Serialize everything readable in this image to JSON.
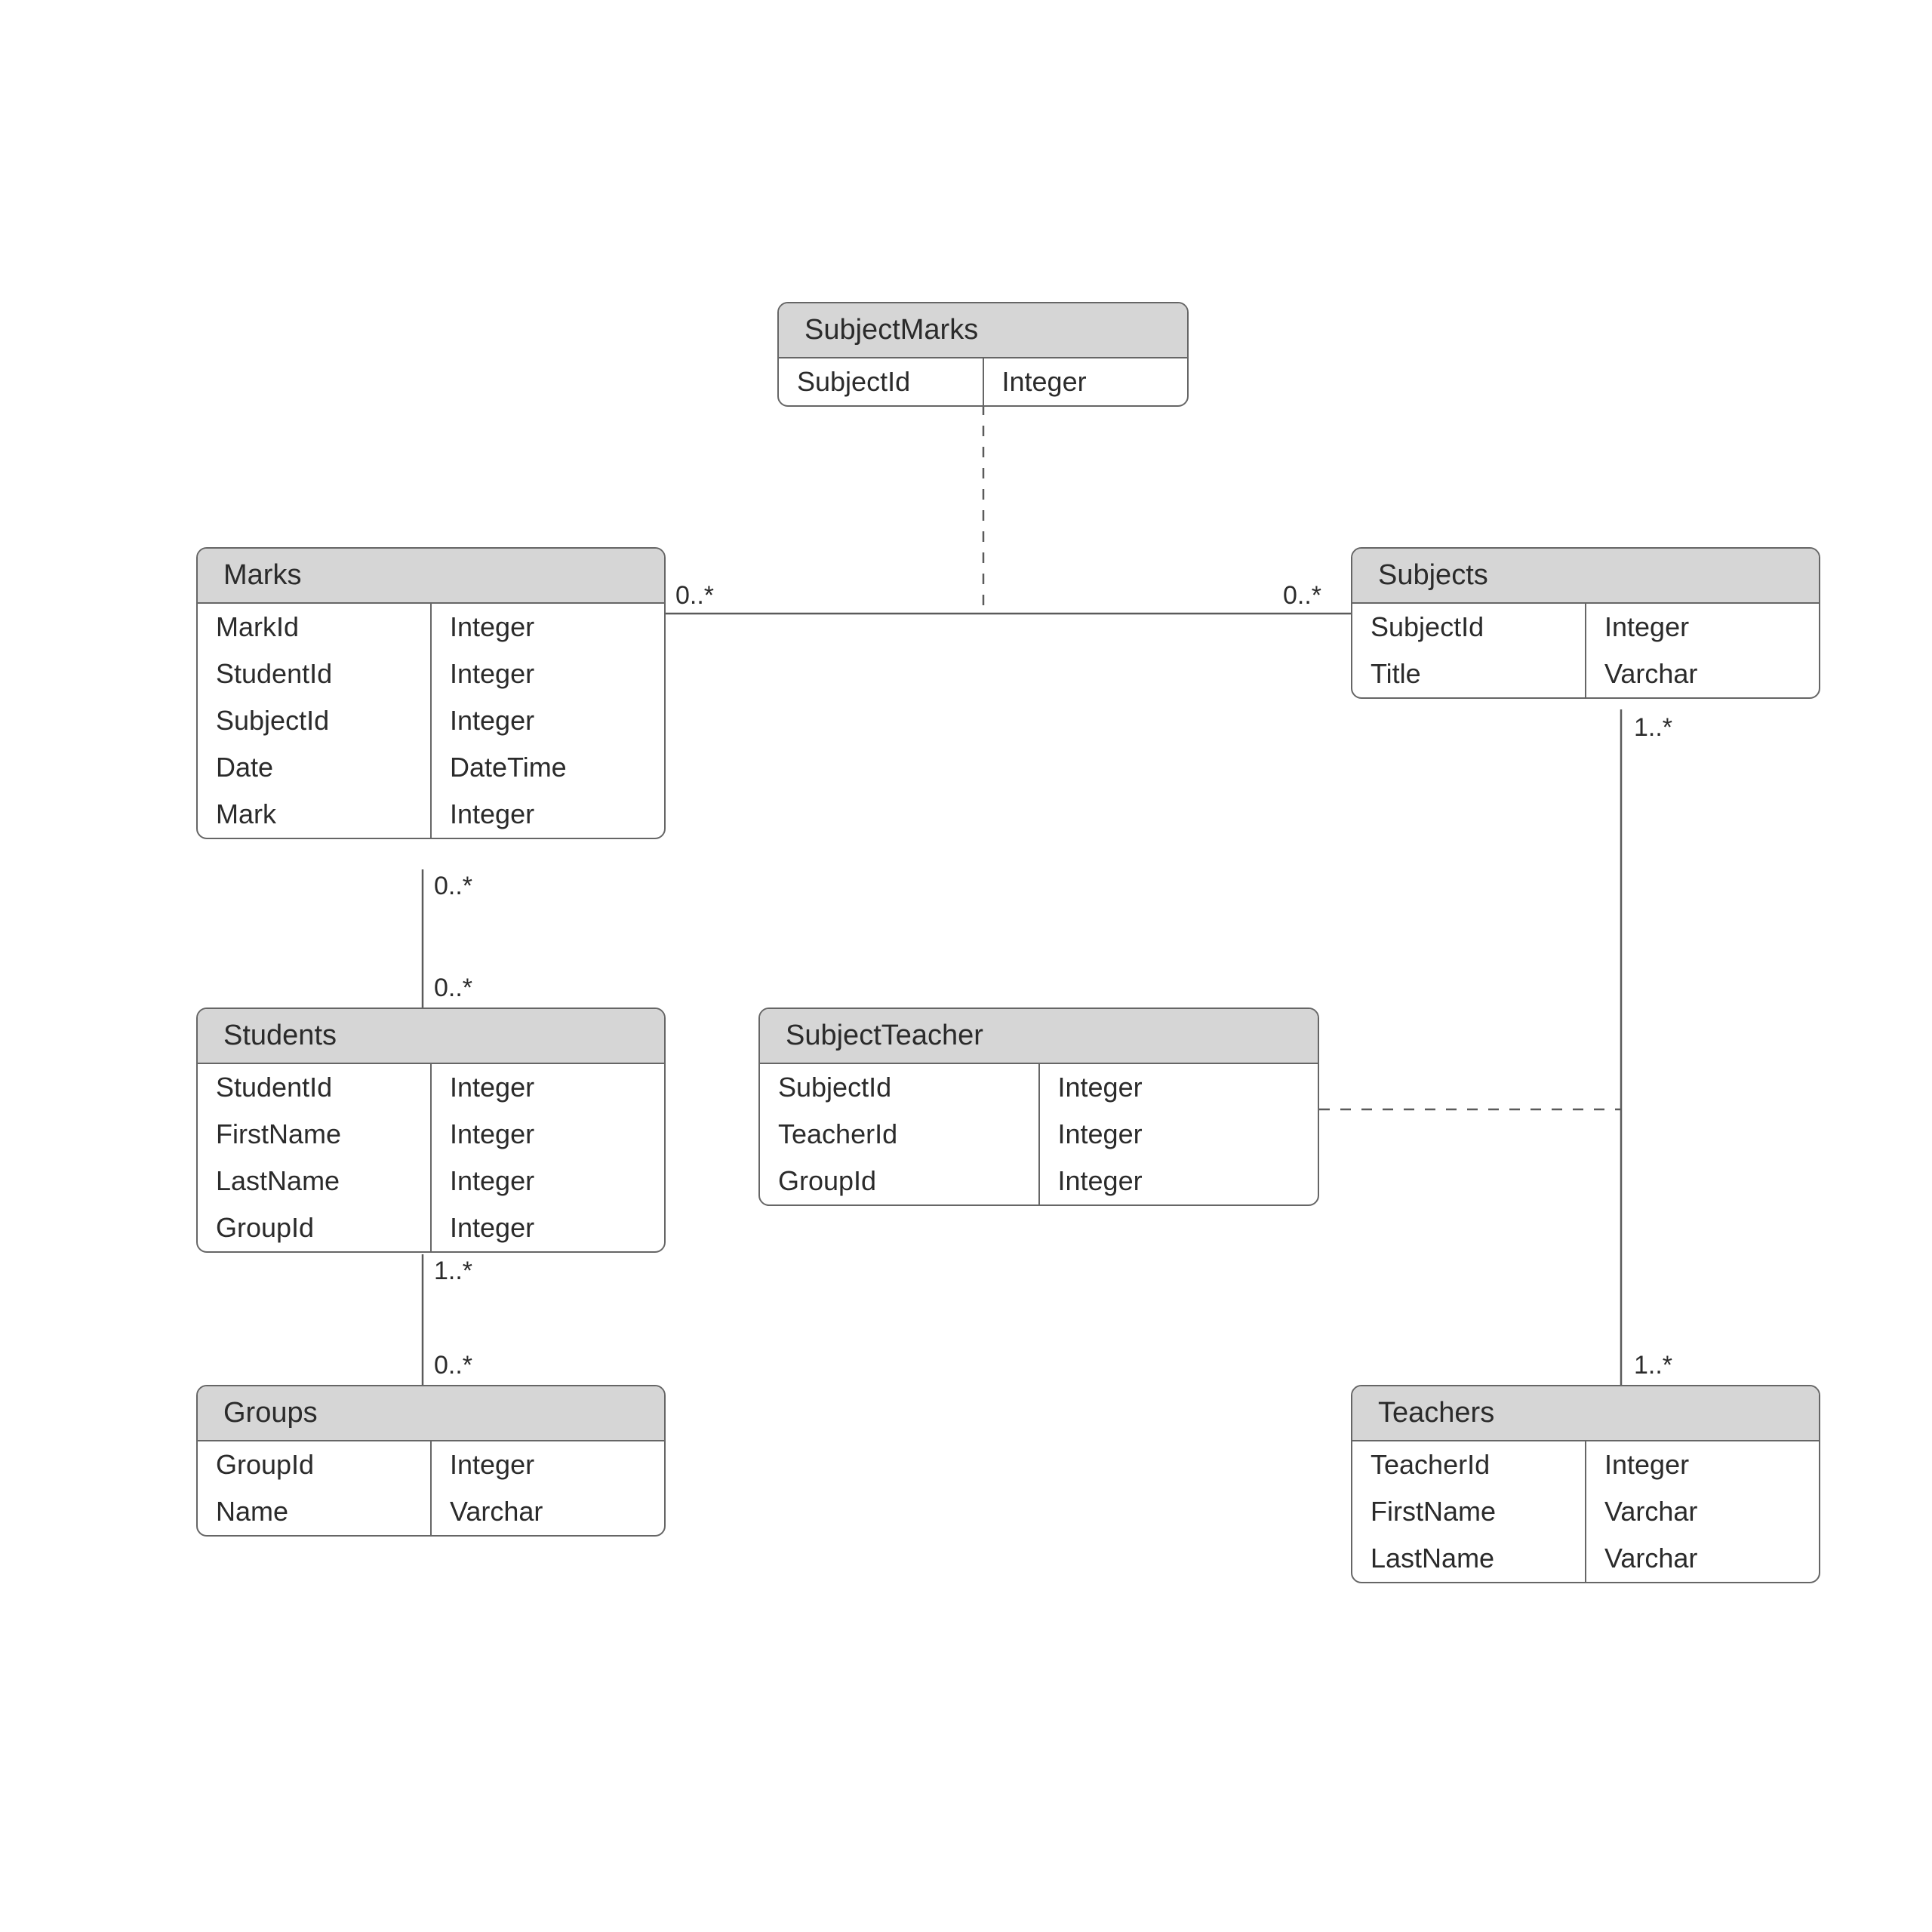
{
  "entities": {
    "subjectMarks": {
      "title": "SubjectMarks",
      "fields": [
        {
          "name": "SubjectId",
          "type": "Integer"
        }
      ]
    },
    "marks": {
      "title": "Marks",
      "fields": [
        {
          "name": "MarkId",
          "type": "Integer"
        },
        {
          "name": "StudentId",
          "type": "Integer"
        },
        {
          "name": "SubjectId",
          "type": "Integer"
        },
        {
          "name": "Date",
          "type": "DateTime"
        },
        {
          "name": "Mark",
          "type": "Integer"
        }
      ]
    },
    "subjects": {
      "title": "Subjects",
      "fields": [
        {
          "name": "SubjectId",
          "type": "Integer"
        },
        {
          "name": "Title",
          "type": "Varchar"
        }
      ]
    },
    "students": {
      "title": "Students",
      "fields": [
        {
          "name": "StudentId",
          "type": "Integer"
        },
        {
          "name": "FirstName",
          "type": "Integer"
        },
        {
          "name": "LastName",
          "type": "Integer"
        },
        {
          "name": "GroupId",
          "type": "Integer"
        }
      ]
    },
    "subjectTeacher": {
      "title": "SubjectTeacher",
      "fields": [
        {
          "name": "SubjectId",
          "type": "Integer"
        },
        {
          "name": "TeacherId",
          "type": "Integer"
        },
        {
          "name": "GroupId",
          "type": "Integer"
        }
      ]
    },
    "groups": {
      "title": "Groups",
      "fields": [
        {
          "name": "GroupId",
          "type": "Integer"
        },
        {
          "name": "Name",
          "type": "Varchar"
        }
      ]
    },
    "teachers": {
      "title": "Teachers",
      "fields": [
        {
          "name": "TeacherId",
          "type": "Integer"
        },
        {
          "name": "FirstName",
          "type": "Varchar"
        },
        {
          "name": "LastName",
          "type": "Varchar"
        }
      ]
    }
  },
  "cardinalities": {
    "marksToSubjects_left": "0..*",
    "marksToSubjects_right": "0..*",
    "marksToStudents_top": "0..*",
    "marksToStudents_bottom": "0..*",
    "studentsToGroups_top": "1..*",
    "studentsToGroups_bottom": "0..*",
    "subjectsToTeachers_top": "1..*",
    "subjectsToTeachers_bottom": "1..*"
  }
}
